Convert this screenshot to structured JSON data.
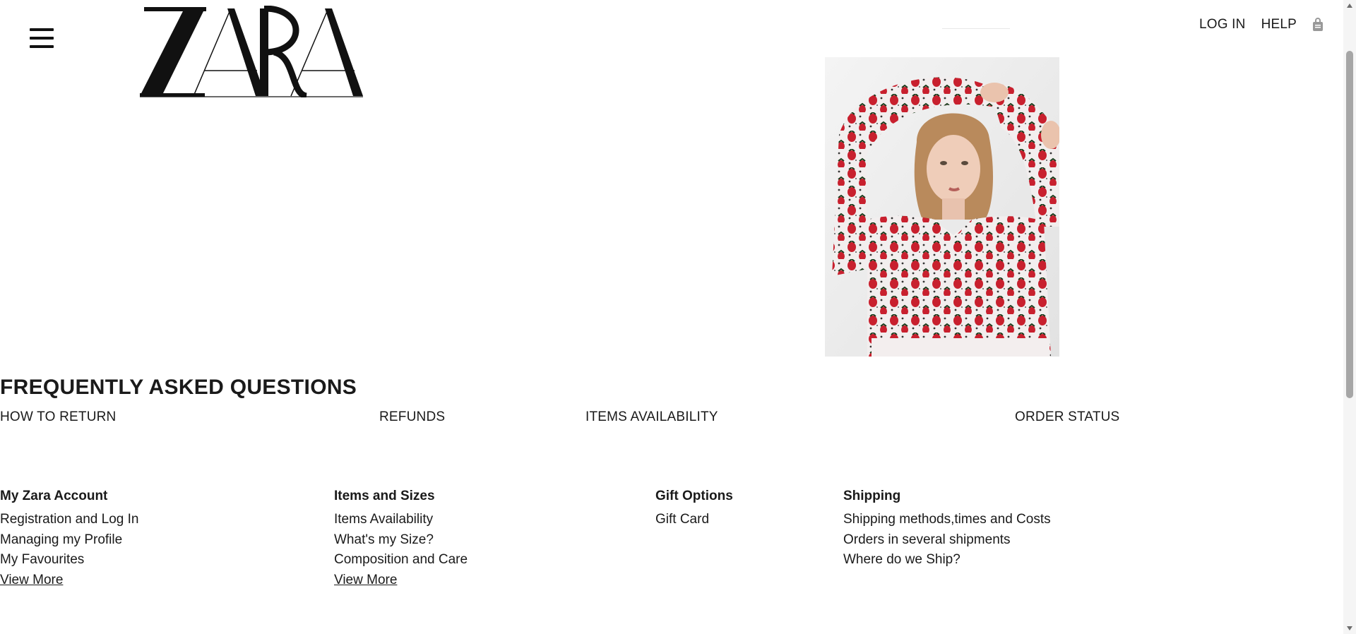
{
  "header": {
    "menu_icon": "hamburger-menu-icon",
    "logo_text": "ZARA",
    "nav": {
      "login": "LOG IN",
      "help": "HELP",
      "bag_icon": "shopping-bag-icon"
    }
  },
  "hero": {
    "image_icon": "product-photo"
  },
  "faq": {
    "title": "FREQUENTLY ASKED QUESTIONS",
    "links": [
      "HOW TO RETURN",
      "REFUNDS",
      "ITEMS AVAILABILITY",
      "ORDER STATUS"
    ]
  },
  "help_columns": [
    {
      "heading": "My Zara Account",
      "links": [
        "Registration and Log In",
        "Managing my Profile",
        "My Favourites"
      ],
      "more": "View More"
    },
    {
      "heading": "Items and Sizes",
      "links": [
        "Items Availability",
        "What's my Size?",
        "Composition and Care"
      ],
      "more": "View More"
    },
    {
      "heading": "Gift Options",
      "links": [
        "Gift Card"
      ]
    },
    {
      "heading": "Shipping",
      "links": [
        "Shipping methods,times and Costs",
        "Orders in several shipments",
        "Where do we Ship?"
      ]
    }
  ],
  "colors": {
    "text": "#1a1a1a",
    "background": "#ffffff",
    "sweater_red": "#c8202e"
  }
}
